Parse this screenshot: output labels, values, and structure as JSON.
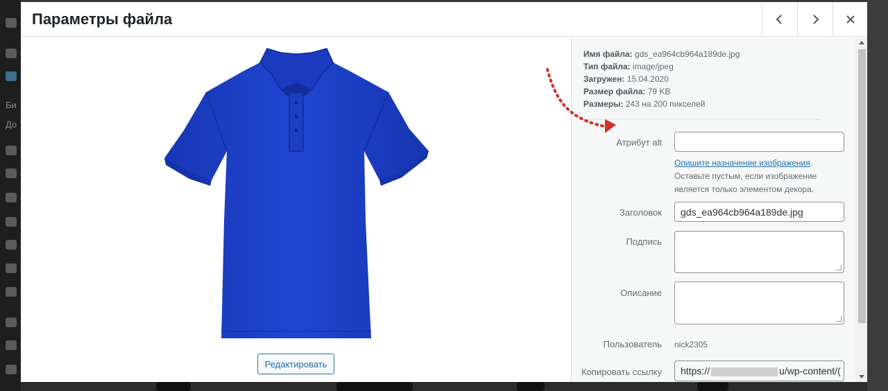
{
  "background": {
    "sidebar_fragments": [
      "Би",
      "До"
    ]
  },
  "modal": {
    "title": "Параметры файла",
    "prev_label": "‹",
    "next_label": "›",
    "close_label": "×"
  },
  "image_pane": {
    "image_icon": "polo-shirt-image",
    "edit_button": "Редактировать"
  },
  "details": {
    "meta": [
      {
        "label": "Имя файла:",
        "value": "gds_ea964cb964a189de.jpg"
      },
      {
        "label": "Тип файла:",
        "value": "image/jpeg"
      },
      {
        "label": "Загружен:",
        "value": "15.04.2020"
      },
      {
        "label": "Размер файла:",
        "value": "79 KB"
      },
      {
        "label": "Размеры:",
        "value": "243 на 200 пикселей"
      }
    ],
    "alt_label": "Атрибут alt",
    "alt_value": "",
    "alt_help_link": "Опишите назначение изображения",
    "alt_help_text": "Оставьте пустым, если изображение является только элементом декора.",
    "title_label": "Заголовок",
    "title_value": "gds_ea964cb964a189de.jpg",
    "caption_label": "Подпись",
    "caption_value": "",
    "description_label": "Описание",
    "description_value": "",
    "user_label": "Пользователь",
    "user_value": "nick2305",
    "copy_link_label": "Копировать ссылку",
    "copy_link_prefix": "https://",
    "copy_link_suffix": "u/wp-content/("
  },
  "colors": {
    "accent": "#2271b1",
    "shirt": "#1c3fc7",
    "annotation_arrow": "#d0312d"
  }
}
